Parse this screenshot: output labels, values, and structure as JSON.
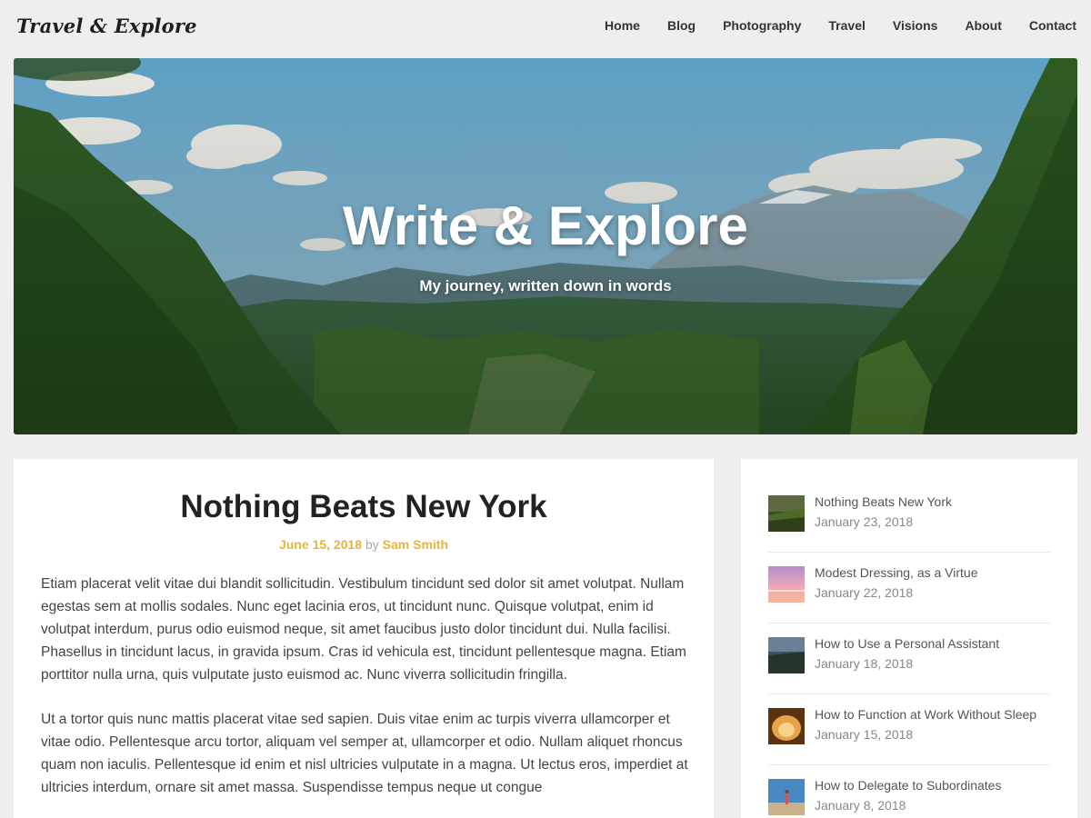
{
  "header": {
    "logo": "Travel & Explore",
    "nav": [
      "Home",
      "Blog",
      "Photography",
      "Travel",
      "Visions",
      "About",
      "Contact"
    ]
  },
  "hero": {
    "title": "Write & Explore",
    "subtitle": "My journey, written down in words"
  },
  "article": {
    "title": "Nothing Beats New York",
    "date": "June 15, 2018",
    "by": "by",
    "author": "Sam Smith",
    "paragraphs": [
      "Etiam placerat velit vitae dui blandit sollicitudin. Vestibulum tincidunt sed dolor sit amet volutpat. Nullam egestas sem at mollis sodales. Nunc eget lacinia eros, ut tincidunt nunc. Quisque volutpat, enim id volutpat interdum, purus odio euismod neque, sit amet faucibus justo dolor tincidunt dui. Nulla facilisi. Phasellus in tincidunt lacus, in gravida ipsum. Cras id vehicula est, tincidunt pellentesque magna. Etiam porttitor nulla urna, quis vulputate justo euismod ac. Nunc viverra sollicitudin fringilla.",
      "Ut a tortor quis nunc mattis placerat vitae sed sapien. Duis vitae enim ac turpis viverra ullamcorper et vitae odio. Pellentesque arcu tortor, aliquam vel semper at, ullamcorper et odio. Nullam aliquet rhoncus quam non iaculis. Pellentesque id enim et nisl ultricies vulputate in a magna. Ut lectus eros, imperdiet at ultricies interdum, ornare sit amet massa. Suspendisse tempus neque ut congue"
    ]
  },
  "sidebar": {
    "recent_posts": [
      {
        "title": "Nothing Beats New York",
        "date": "January 23, 2018",
        "thumb": "field-sunset-thumbnail"
      },
      {
        "title": "Modest Dressing, as a Virtue",
        "date": "January 22, 2018",
        "thumb": "pink-sky-thumbnail"
      },
      {
        "title": "How to Use a Personal Assistant",
        "date": "January 18, 2018",
        "thumb": "dark-landscape-thumbnail"
      },
      {
        "title": "How to Function at Work Without Sleep",
        "date": "January 15, 2018",
        "thumb": "cave-thumbnail"
      },
      {
        "title": "How to Delegate to Subordinates",
        "date": "January 8, 2018",
        "thumb": "person-beach-thumbnail"
      }
    ]
  },
  "colors": {
    "accent": "#e8b33a",
    "background": "#eeeeee",
    "card": "#ffffff"
  }
}
